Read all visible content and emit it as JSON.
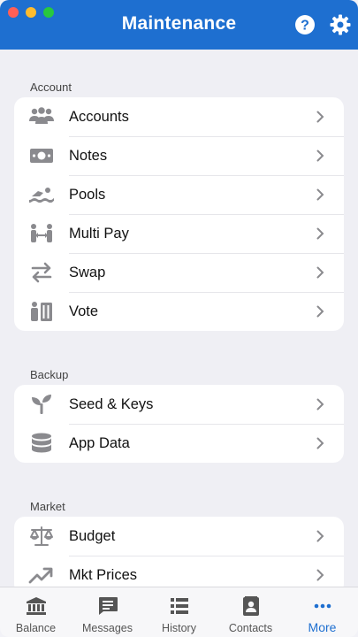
{
  "header": {
    "title": "Maintenance"
  },
  "sections": [
    {
      "label": "Account",
      "items": [
        {
          "label": "Accounts",
          "icon": "users-icon"
        },
        {
          "label": "Notes",
          "icon": "banknote-icon"
        },
        {
          "label": "Pools",
          "icon": "swimmer-icon"
        },
        {
          "label": "Multi Pay",
          "icon": "multi-pay-icon"
        },
        {
          "label": "Swap",
          "icon": "swap-arrows-icon"
        },
        {
          "label": "Vote",
          "icon": "vote-icon"
        }
      ]
    },
    {
      "label": "Backup",
      "items": [
        {
          "label": "Seed & Keys",
          "icon": "seedling-icon"
        },
        {
          "label": "App Data",
          "icon": "database-icon"
        }
      ]
    },
    {
      "label": "Market",
      "items": [
        {
          "label": "Budget",
          "icon": "scale-icon"
        },
        {
          "label": "Mkt Prices",
          "icon": "trending-up-icon"
        }
      ]
    }
  ],
  "tabs": [
    {
      "label": "Balance",
      "icon": "bank-icon",
      "active": false
    },
    {
      "label": "Messages",
      "icon": "message-icon",
      "active": false
    },
    {
      "label": "History",
      "icon": "list-icon",
      "active": false
    },
    {
      "label": "Contacts",
      "icon": "contact-card-icon",
      "active": false
    },
    {
      "label": "More",
      "icon": "more-dots-icon",
      "active": true
    }
  ],
  "colors": {
    "accent": "#1e6fd0",
    "icon_gray": "#8a8a8e"
  }
}
